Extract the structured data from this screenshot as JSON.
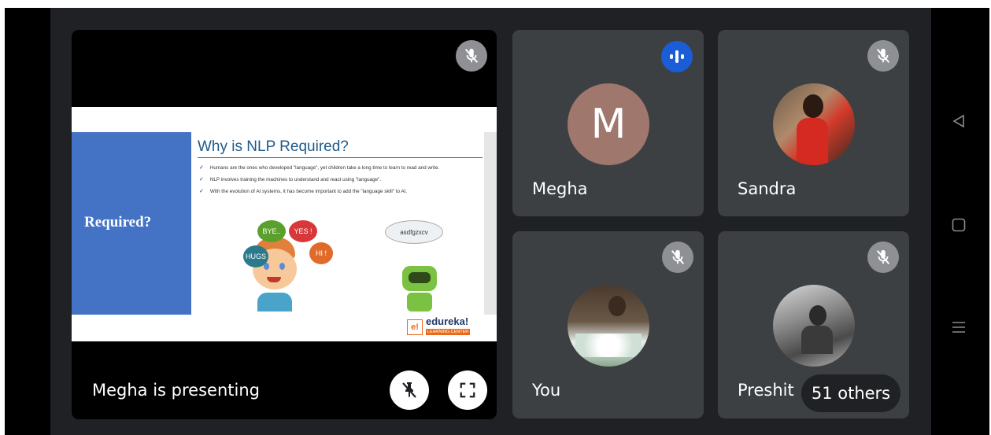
{
  "presentation": {
    "presenting_label": "Megha is presenting",
    "slide": {
      "title": "Why is NLP Required?",
      "side_heading": "Required?",
      "bullets": [
        "Humans are the ones who developed \"language\", yet children take a long time to learn to read and write.",
        "NLP involves training the machines to understand and react using \"language\".",
        "With the evolution of AI systems, it has become important to add the \"language skill\" to AI."
      ],
      "bubbles": [
        "BYE..",
        "YES !",
        "HUGS",
        "HI !"
      ],
      "robot_thought": "asdfgzxcv",
      "logo_mark": "e!",
      "logo_text": "edureka!",
      "logo_sub": "LEARNING CENTER"
    }
  },
  "participants": [
    {
      "name": "Megha",
      "initial": "M",
      "status": "speaking"
    },
    {
      "name": "Sandra",
      "status": "muted"
    },
    {
      "name": "You",
      "status": "muted"
    },
    {
      "name": "Preshit",
      "status": "muted"
    }
  ],
  "others_label": "51 others",
  "colors": {
    "tile_bg": "#3c4043",
    "meet_bg": "#202124",
    "speaking_badge": "#1a5dd6",
    "avatar_megha": "#a0776d",
    "mute_badge": "#8e9094"
  },
  "icons": {
    "mic_off": "mic-off-icon",
    "speaking": "audio-wave-icon",
    "pin_off": "pin-off-icon",
    "fullscreen": "fullscreen-icon",
    "nav_back": "triangle-back-icon",
    "nav_home": "square-home-icon",
    "nav_menu": "lines-menu-icon"
  }
}
